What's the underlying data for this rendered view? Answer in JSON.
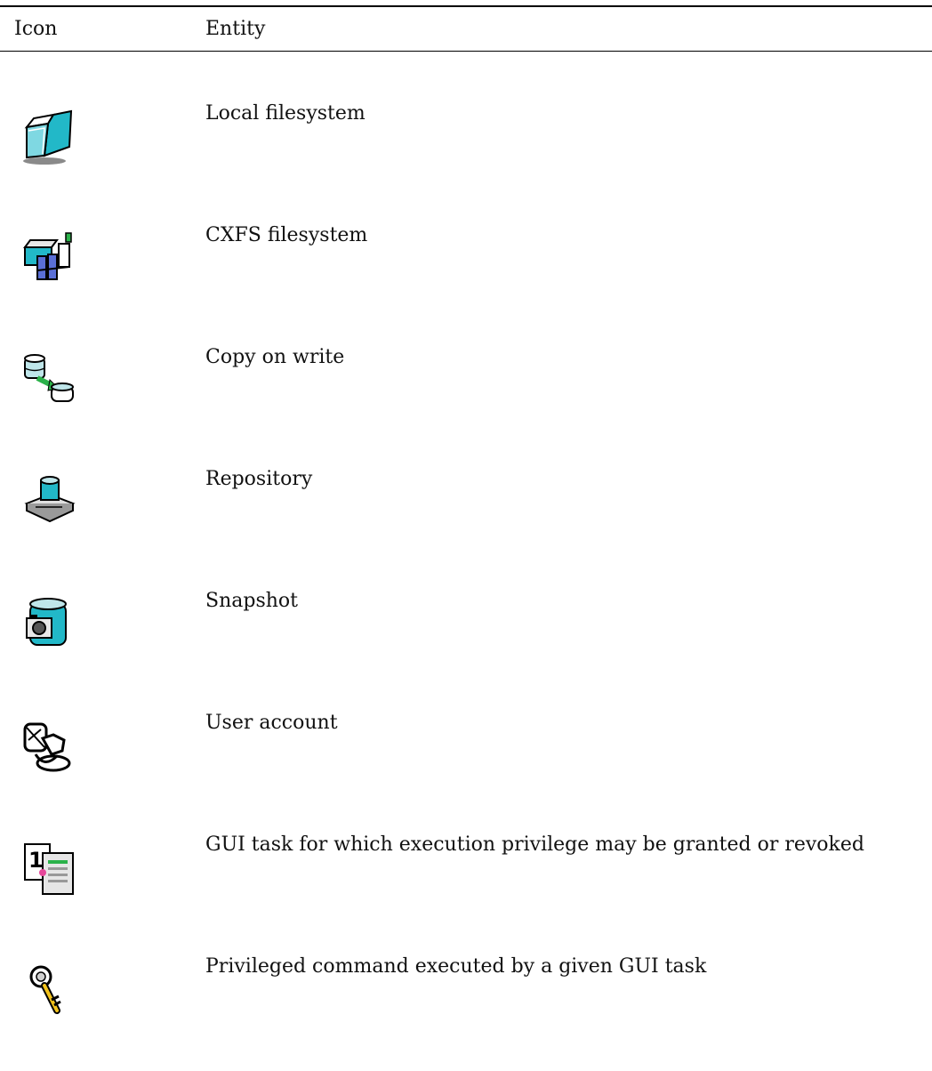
{
  "table": {
    "headers": {
      "icon": "Icon",
      "entity": "Entity"
    },
    "rows": [
      {
        "icon": "local-filesystem-icon",
        "label": "Local filesystem"
      },
      {
        "icon": "cxfs-filesystem-icon",
        "label": "CXFS filesystem"
      },
      {
        "icon": "copy-on-write-icon",
        "label": "Copy on write"
      },
      {
        "icon": "repository-icon",
        "label": "Repository"
      },
      {
        "icon": "snapshot-icon",
        "label": "Snapshot"
      },
      {
        "icon": "user-account-icon",
        "label": "User account"
      },
      {
        "icon": "gui-task-icon",
        "label": "GUI task for which execution privilege may be granted or revoked"
      },
      {
        "icon": "privileged-command-icon",
        "label": "Privileged command executed by a given GUI task"
      }
    ]
  },
  "colors": {
    "cyan": "#22b8c8",
    "green": "#2bb24a",
    "yellow": "#f2c21b",
    "gray": "#9a9a9a"
  }
}
